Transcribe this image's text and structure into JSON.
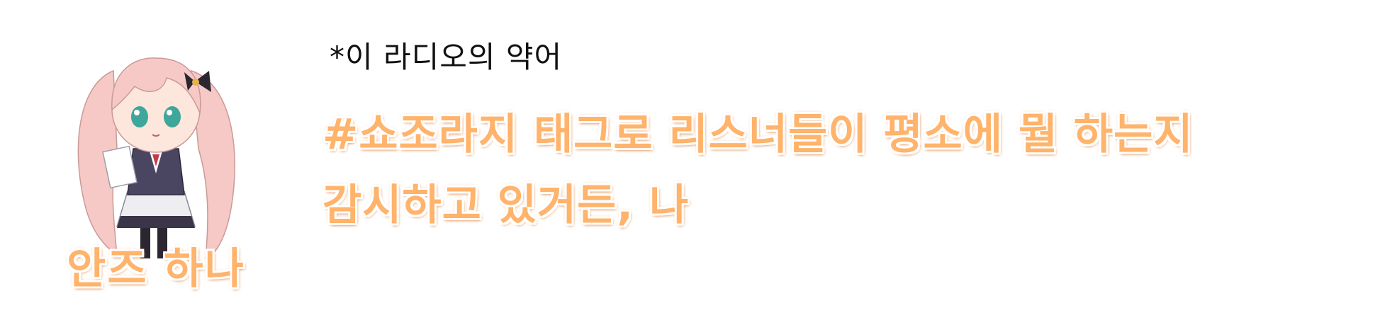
{
  "speaker": {
    "name": "안즈 하나"
  },
  "note": {
    "text": "*이 라디오의 약어"
  },
  "subtitle": {
    "lines": [
      "#쇼조라지 태그로 리스너들이 평소에 뭘 하는지",
      "감시하고 있거든, 나"
    ]
  },
  "colors": {
    "subtitle_fill": "#ffb36b",
    "subtitle_outline": "#ffffff",
    "subtitle_glow": "#e8823a",
    "note_text": "#111111",
    "background": "#ffffff"
  }
}
